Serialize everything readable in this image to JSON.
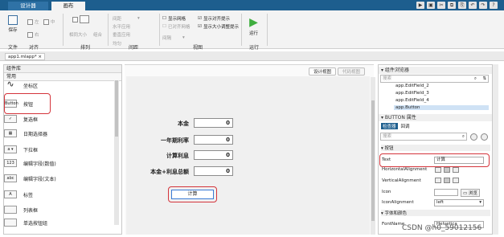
{
  "toolstrip": {
    "tabs": [
      "设计器",
      "画布"
    ],
    "groups": [
      "文件",
      "对齐",
      "排列",
      "间距",
      "视图",
      "运行"
    ],
    "file_buttons": [
      "保存"
    ],
    "align_buttons": [
      "左",
      "中",
      "右"
    ],
    "arrange_buttons": [
      "相同大小",
      "组合"
    ],
    "spacing_items": [
      "间距",
      "水平应用",
      "垂直应用",
      "均匀"
    ],
    "view_items": [
      "显示网格",
      "已对齐网格",
      "间隔",
      "显示对齐提示",
      "显示大小调整提示"
    ],
    "run_label": "运行"
  },
  "file_tab": "app1.mlapp* ×",
  "component_library": {
    "title": "组件库",
    "section": "常用",
    "items": [
      "坐标区",
      "按钮",
      "复选框",
      "日期选择器",
      "下拉框",
      "编辑字段(数值)",
      "编辑字段(文本)",
      "标签",
      "列表框",
      "单选按钮组"
    ],
    "icons": [
      "axes-icon",
      "button-icon",
      "checkbox-icon",
      "date-picker-icon",
      "dropdown-icon",
      "numeric-field-icon",
      "text-field-icon",
      "label-icon",
      "listbox-icon",
      "radio-group-icon"
    ],
    "icon_text": [
      "",
      "Button",
      "✓",
      "▦",
      "a ▾",
      "123",
      "abc",
      "A",
      "",
      ""
    ]
  },
  "canvas": {
    "view_tabs": [
      "设计视图",
      "代码视图"
    ],
    "fields": [
      {
        "label": "本金",
        "value": "0"
      },
      {
        "label": "一年期利率",
        "value": "0"
      },
      {
        "label": "计算利息",
        "value": "0"
      },
      {
        "label": "本金+利息总额",
        "value": "0"
      }
    ],
    "button_text": "计算"
  },
  "browser": {
    "title": "组件浏览器",
    "search_placeholder": "搜索",
    "tree_items": [
      "app.EditField_2",
      "app.EditField_3",
      "app.EditField_4",
      "app.Button"
    ],
    "selected_index": 3
  },
  "inspector": {
    "title": "BUTTON 属性",
    "tabs": [
      "检查器",
      "回调"
    ],
    "search_placeholder": "搜索",
    "section_button": "按钮",
    "rows": [
      {
        "label": "Text",
        "value": "计算"
      },
      {
        "label": "HorizontalAlignment",
        "value": ""
      },
      {
        "label": "VerticalAlignment",
        "value": ""
      },
      {
        "label": "Icon",
        "value": "",
        "browse": "浏览"
      },
      {
        "label": "IconAlignment",
        "value": "left"
      }
    ],
    "section_font": "字体和颜色",
    "font_row": {
      "label": "FontName",
      "value": "Helvetica"
    }
  },
  "watermark": "CSDN @h0_59012156"
}
